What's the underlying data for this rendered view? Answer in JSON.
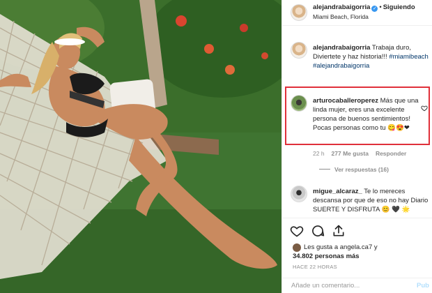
{
  "post": {
    "author": "alejandrabaigorria",
    "location": "Miami Beach, Florida",
    "follow_label": "Siguiendo",
    "caption_author": "alejandrabaigorria",
    "caption_text": "Trabaja duro, Diviertete y haz historia!!!",
    "caption_hashtags": "#miamibeach #alejandrabaigorria"
  },
  "comments": [
    {
      "author": "arturocaballeroperez",
      "text": "Más que una linda mujer, eres una excelente persona de buenos sentimientos! Pocas personas como tu",
      "emojis": "😋😍❤",
      "time": "22 h",
      "likes": "277 Me gusta",
      "reply_label": "Responder"
    },
    {
      "author": "migue_alcaraz_",
      "text": "Te lo mereces descansa por que de eso no hay Diario SUERTE Y DISFRUTA",
      "emojis": "😊 🖤 🌟"
    }
  ],
  "replies_label": "Ver respuestas (16)",
  "likes": {
    "line1": "Les gusta a angela.ca7 y",
    "line2": "34.802 personas más"
  },
  "timestamp": "HACE 22 HORAS",
  "add_comment": {
    "placeholder": "Añade un comentario...",
    "publish": "Pub"
  },
  "icons": [
    "heart-icon",
    "comment-icon",
    "share-icon",
    "verified-icon"
  ],
  "colors": {
    "link": "#003569",
    "verified": "#3897f0",
    "highlight": "#e0303a",
    "muted": "#8e8e8e"
  }
}
